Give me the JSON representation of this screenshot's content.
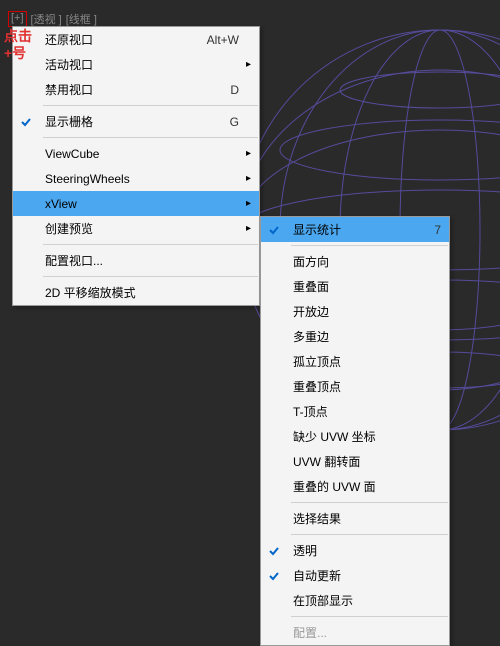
{
  "viewport_labels": {
    "plus": "[+]",
    "view": "[透视 ]",
    "mode": "[线框 ]"
  },
  "annotation": {
    "line1": "点击",
    "line2": "+号"
  },
  "main_menu": {
    "items": [
      {
        "label": "还原视口",
        "shortcut": "Alt+W"
      },
      {
        "label": "活动视口",
        "submenu": true
      },
      {
        "label": "禁用视口",
        "shortcut": "D"
      }
    ],
    "grid": {
      "label": "显示栅格",
      "shortcut": "G",
      "checked": true
    },
    "tools": [
      {
        "label": "ViewCube",
        "submenu": true
      },
      {
        "label": "SteeringWheels",
        "submenu": true
      },
      {
        "label": "xView",
        "submenu": true,
        "highlighted": true
      },
      {
        "label": "创建预览",
        "submenu": true
      }
    ],
    "config": {
      "label": "配置视口..."
    },
    "pan": {
      "label": "2D 平移缩放模式"
    }
  },
  "sub_menu": {
    "stats": {
      "label": "显示统计",
      "shortcut": "7",
      "checked": true,
      "highlighted": true
    },
    "checks": [
      {
        "label": "面方向"
      },
      {
        "label": "重叠面"
      },
      {
        "label": "开放边"
      },
      {
        "label": "多重边"
      },
      {
        "label": "孤立顶点"
      },
      {
        "label": "重叠顶点"
      },
      {
        "label": "T-顶点"
      },
      {
        "label": "缺少 UVW 坐标"
      },
      {
        "label": "UVW 翻转面"
      },
      {
        "label": "重叠的 UVW 面"
      }
    ],
    "select": {
      "label": "选择结果"
    },
    "opts": [
      {
        "label": "透明",
        "checked": true
      },
      {
        "label": "自动更新",
        "checked": true
      },
      {
        "label": "在顶部显示"
      }
    ],
    "cfg": {
      "label": "配置...",
      "disabled": true
    }
  }
}
